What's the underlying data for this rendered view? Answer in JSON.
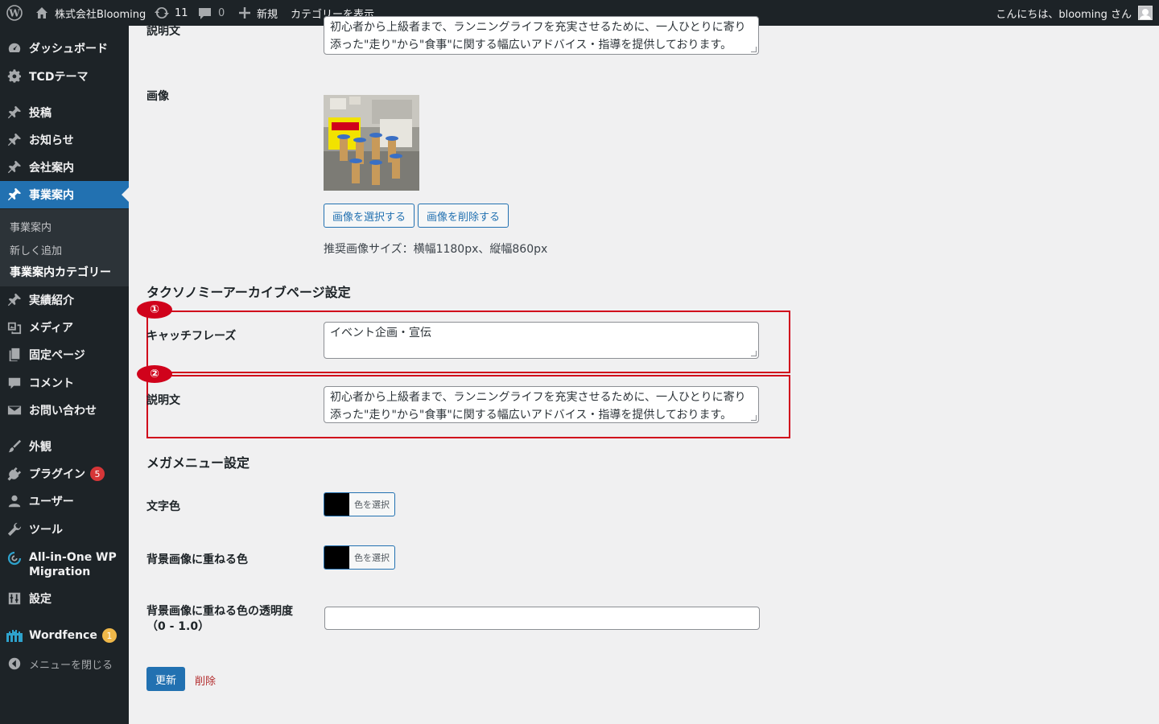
{
  "adminbar": {
    "site_name": "株式会社Blooming",
    "updates_count": "11",
    "comments_count": "0",
    "new_label": "新規",
    "view_category_label": "カテゴリーを表示",
    "greeting": "こんにちは、blooming さん"
  },
  "sidebar": {
    "items": [
      {
        "label": "ダッシュボード"
      },
      {
        "label": "TCDテーマ"
      },
      {
        "label": "投稿"
      },
      {
        "label": "お知らせ"
      },
      {
        "label": "会社案内"
      },
      {
        "label": "事業案内"
      },
      {
        "label": "実績紹介"
      },
      {
        "label": "メディア"
      },
      {
        "label": "固定ページ"
      },
      {
        "label": "コメント"
      },
      {
        "label": "お問い合わせ"
      },
      {
        "label": "外観"
      },
      {
        "label": "プラグイン",
        "badge": "5"
      },
      {
        "label": "ユーザー"
      },
      {
        "label": "ツール"
      },
      {
        "label": "All-in-One WP Migration"
      },
      {
        "label": "設定"
      },
      {
        "label": "Wordfence",
        "badge": "1"
      },
      {
        "label": "メニューを閉じる"
      }
    ],
    "submenu": [
      "事業案内",
      "新しく追加",
      "事業案内カテゴリー"
    ]
  },
  "form": {
    "top_description_label": "説明文",
    "top_description_value": "初心者から上級者まで、ランニングライフを充実させるために、一人ひとりに寄り添った\"走り\"から\"食事\"に関する幅広いアドバイス・指導を提供しております。",
    "image_label": "画像",
    "select_image_button": "画像を選択する",
    "delete_image_button": "画像を削除する",
    "image_size_note": "推奨画像サイズ：横幅1180px、縦幅860px",
    "taxonomy_section_title": "タクソノミーアーカイブページ設定",
    "annotation_1": "①",
    "annotation_2": "②",
    "catchphrase_label": "キャッチフレーズ",
    "catchphrase_value": "イベント企画・宣伝",
    "description_label": "説明文",
    "description_value": "初心者から上級者まで、ランニングライフを充実させるために、一人ひとりに寄り添った\"走り\"から\"食事\"に関する幅広いアドバイス・指導を提供しております。",
    "megamenu_section_title": "メガメニュー設定",
    "text_color_label": "文字色",
    "bg_overlay_color_label": "背景画像に重ねる色",
    "color_select_button": "色を選択",
    "opacity_label_line1": "背景画像に重ねる色の透明度",
    "opacity_label_line2": "（0 - 1.0）",
    "opacity_value": "",
    "update_button": "更新",
    "delete_link": "削除"
  },
  "colors": {
    "admin_dark": "#1d2327",
    "accent_blue": "#2271b1",
    "annotation_red": "#d0021b",
    "swatch": "#000000"
  }
}
